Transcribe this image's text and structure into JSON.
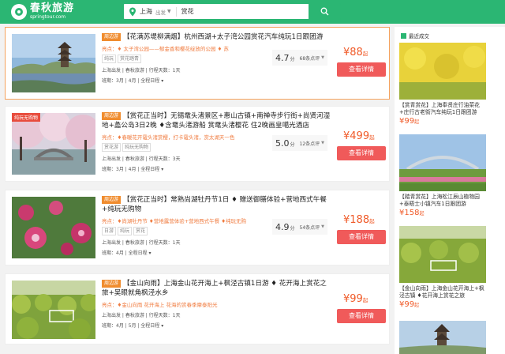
{
  "header": {
    "logo_name": "春秋旅游",
    "logo_domain": "springtour.com",
    "city": "上海",
    "depart_label": "出发",
    "search_value": "赏花"
  },
  "products": [
    {
      "badge": "周边游",
      "title": "【花满苏堤柳满烟】杭州西湖+太子湾公园赏花汽车纯玩1日跟团游",
      "sub": "亮点：♦ 太子湾公园——郁金香和樱花绽放的公园 ♦ 苏",
      "tags": [
        "纯玩",
        "赏花踏青"
      ],
      "meta": "上海出发 | 春秋旅游 | 行程天数：1天",
      "dates": "班期：3月 | 4月 | 全程日程 ▾",
      "score": "4.7",
      "score_unit": "分",
      "count": "68条点评",
      "price": "¥88",
      "price_unit": "起",
      "button": "查看详情"
    },
    {
      "img_tag": "纯玩无购物",
      "badge": "周边游",
      "title": "【赏花正当时】无锡鼋头渚景区+惠山古镇+南禅寺步行街+尚贤河湿地+蠡公岛3日2晚 ♦含鼋头渚游船 赏鼋头渚樱花 住2晚画皇噶光酒店",
      "sub": "亮点：♦春暖花开鼋头渚赏樱，打卡鼋头渚，赏太湖天一色",
      "tags": [
        "赏花游",
        "纯玩无购物"
      ],
      "meta": "上海出发 | 春秋旅游 | 行程天数：3天",
      "dates": "班期：3月 | 4月 | 全程日程 ▾",
      "score": "5.0",
      "score_unit": "分",
      "count": "12条点评",
      "price": "¥499",
      "price_unit": "起",
      "button": "查看详情"
    },
    {
      "badge": "周边游",
      "title": "【赏花正当时】常熟尚湖牡丹节1日 ♦ 赠送御膳体验+营地西式午餐+纯玩无购物",
      "sub": "亮点：♦尚湖牡丹节 ♦营地露营体验+营地西式午餐 ♦纯玩无购",
      "tags": [
        "日游",
        "纯玩",
        "赏花"
      ],
      "meta": "上海出发 | 春秋旅游 | 行程天数：1天",
      "dates": "班期：4月 | 全程日程 ▾",
      "score": "4.9",
      "score_unit": "分",
      "count": "54条点评",
      "price": "¥188",
      "price_unit": "起",
      "button": "查看详情"
    },
    {
      "badge": "周边游",
      "title": "【金山向雨】上海金山花开海上+枫泾古镇1日游 ♦ 花开海上赏花之旅+吴眼就角枫泾水乡",
      "sub": "亮点：♦金山向雨 花开海上 花海的赏春季摩泰阳光",
      "tags": [],
      "meta": "上海出发 | 春秋旅游 | 行程天数：1天",
      "dates": "班期：4月 | 5月 | 全程日程 ▾",
      "score": "",
      "score_unit": "",
      "count": "",
      "price": "¥99",
      "price_unit": "起",
      "button": "查看详情"
    }
  ],
  "sidebar": {
    "heading": "最近成交",
    "items": [
      {
        "title": "【赏青赏花】上海奉贤庄行油菜花+庄行古老街汽车纯玩1日跟团游",
        "price": "¥99",
        "price_unit": "起"
      },
      {
        "title": "【踏青赏花】上海松江辰山植物园+泰晤士小镇汽车1日跟团游",
        "price": "¥158",
        "price_unit": "起"
      },
      {
        "title": "【金山向雨】上海金山花开海上+枫泾古镇 ♦花开海上赏花之旅",
        "price": "¥99",
        "price_unit": "起"
      }
    ]
  },
  "colors": {
    "brand": "#2bb673",
    "price": "#f05a28",
    "button": "#f05a5a",
    "badge": "#f08c2e"
  }
}
